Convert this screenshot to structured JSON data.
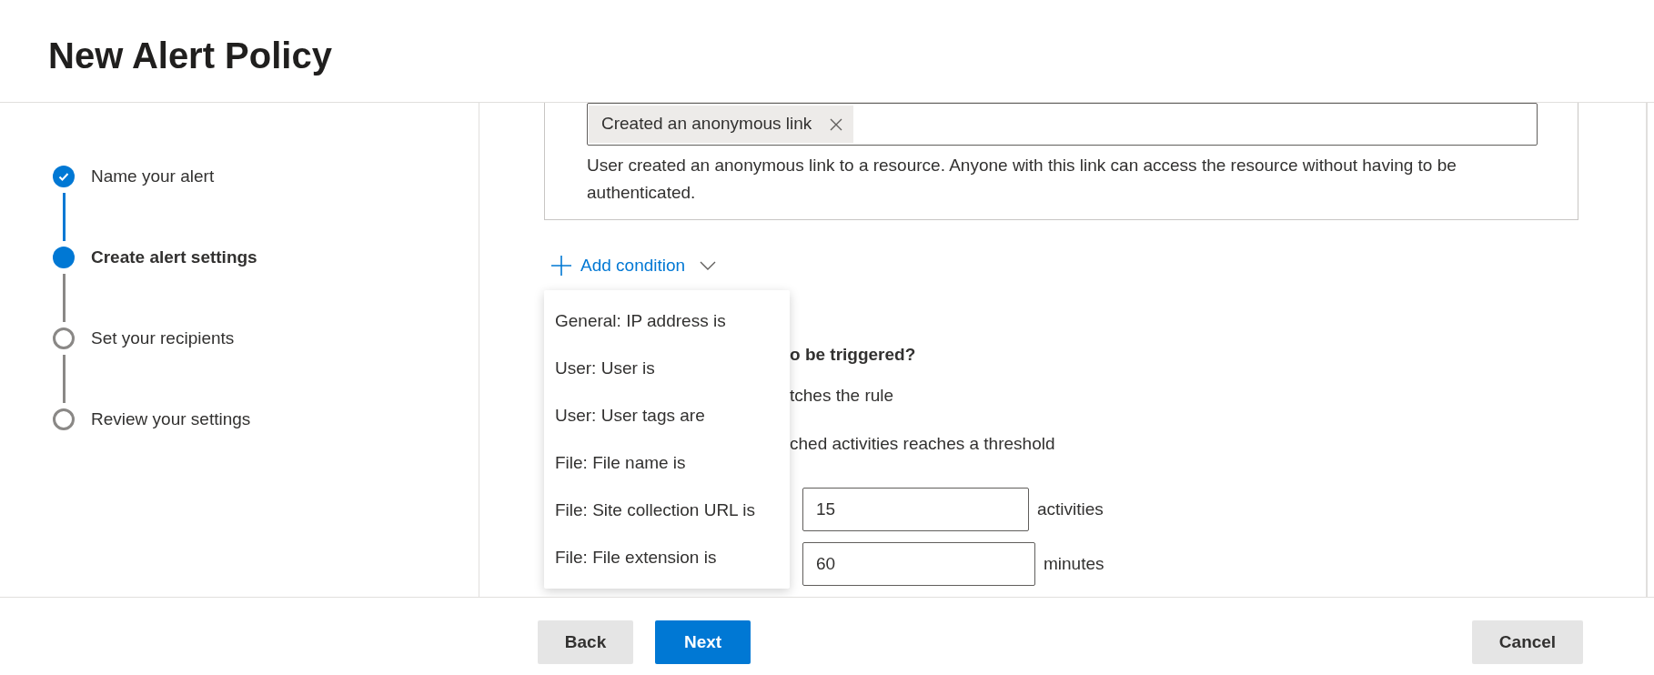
{
  "title": "New Alert Policy",
  "steps": [
    {
      "label": "Name your alert",
      "kind": "done"
    },
    {
      "label": "Create alert settings",
      "kind": "current"
    },
    {
      "label": "Set your recipients",
      "kind": "todo"
    },
    {
      "label": "Review your settings",
      "kind": "todo"
    }
  ],
  "activity_field": {
    "chips": [
      "Created an anonymous link"
    ]
  },
  "description": "User created an anonymous link to a resource. Anyone with this link can access the resource without having to be authenticated.",
  "add_condition": {
    "label": "Add condition",
    "expanded": true
  },
  "condition_menu": [
    "General: IP address is",
    "User: User is",
    "User: User tags are",
    "File: File name is",
    "File: Site collection URL is",
    "File: File extension is"
  ],
  "trigger": {
    "question": "o be triggered?",
    "options": [
      "tches the rule",
      "ched activities reaches a threshold"
    ]
  },
  "threshold": [
    {
      "value": "15",
      "unit": "activities"
    },
    {
      "value": "60",
      "unit": "minutes"
    }
  ],
  "buttons": {
    "back": "Back",
    "next": "Next",
    "cancel": "Cancel"
  }
}
